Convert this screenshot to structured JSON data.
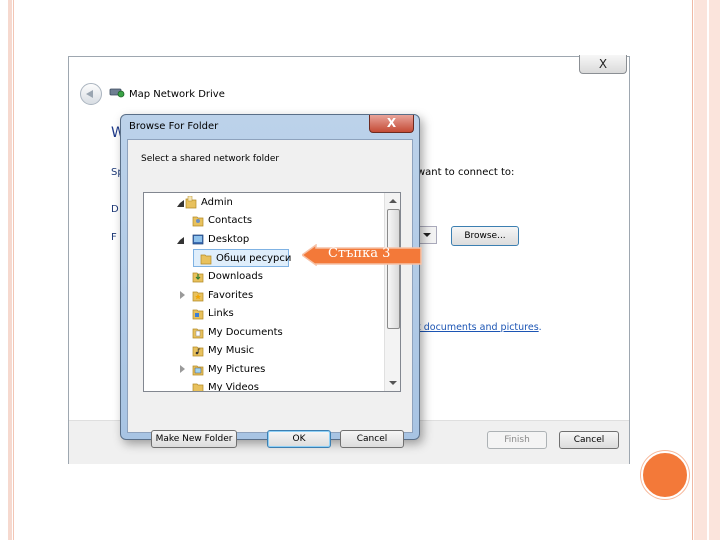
{
  "wizard": {
    "title": "Map Network Drive",
    "close_label": "X",
    "heading_partial": "W",
    "specify_partial": "Sp",
    "drive_partial": "D",
    "folder_partial": "F",
    "connect_text": "want to connect to:",
    "browse_label": "Browse...",
    "link_text": "t documents and pictures",
    "link_suffix": ".",
    "finish_label": "Finish",
    "cancel_label": "Cancel"
  },
  "browse_dialog": {
    "title": "Browse For Folder",
    "close_label": "X",
    "instruction": "Select a shared network folder",
    "tree": [
      {
        "label": "Admin",
        "expander": "expanded"
      },
      {
        "label": "Contacts",
        "expander": "none"
      },
      {
        "label": "Desktop",
        "expander": "expanded"
      },
      {
        "label": "Общи ресурси",
        "expander": "none",
        "selected": true
      },
      {
        "label": "Downloads",
        "expander": "none"
      },
      {
        "label": "Favorites",
        "expander": "collapsed"
      },
      {
        "label": "Links",
        "expander": "none"
      },
      {
        "label": "My Documents",
        "expander": "none"
      },
      {
        "label": "My Music",
        "expander": "none"
      },
      {
        "label": "My Pictures",
        "expander": "none"
      },
      {
        "label": "My Videos",
        "expander": "none"
      }
    ],
    "new_folder_label": "Make New Folder",
    "ok_label": "OK",
    "cancel_label": "Cancel"
  },
  "callout": {
    "text": "Стъпка 3",
    "color": "#f37939"
  },
  "colors": {
    "accent": "#f37939",
    "link": "#1c55b4",
    "selection": "#dfeefb"
  }
}
